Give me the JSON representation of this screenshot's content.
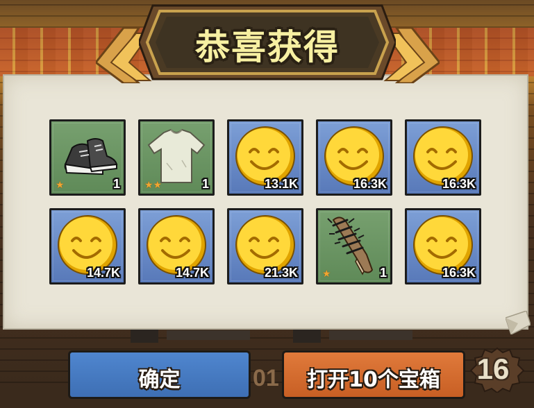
{
  "title": "恭喜获得",
  "items": [
    {
      "name": "sneakers",
      "icon": "sneakers-icon",
      "bg": "green",
      "stars": "★",
      "count": "1"
    },
    {
      "name": "t-shirt",
      "icon": "tshirt-icon",
      "bg": "green",
      "stars": "★★",
      "count": "1"
    },
    {
      "name": "coin",
      "icon": "smiley-coin-icon",
      "bg": "blue",
      "stars": "",
      "count": "13.1K"
    },
    {
      "name": "coin",
      "icon": "smiley-coin-icon",
      "bg": "blue",
      "stars": "",
      "count": "16.3K"
    },
    {
      "name": "coin",
      "icon": "smiley-coin-icon",
      "bg": "blue",
      "stars": "",
      "count": "16.3K"
    },
    {
      "name": "coin",
      "icon": "smiley-coin-icon",
      "bg": "blue",
      "stars": "",
      "count": "14.7K"
    },
    {
      "name": "coin",
      "icon": "smiley-coin-icon",
      "bg": "blue",
      "stars": "",
      "count": "14.7K"
    },
    {
      "name": "coin",
      "icon": "smiley-coin-icon",
      "bg": "blue",
      "stars": "",
      "count": "21.3K"
    },
    {
      "name": "spiked-bat",
      "icon": "spiked-bat-icon",
      "bg": "green",
      "stars": "★",
      "count": "1"
    },
    {
      "name": "coin",
      "icon": "smiley-coin-icon",
      "bg": "blue",
      "stars": "",
      "count": "16.3K"
    }
  ],
  "buttons": {
    "confirm": "确定",
    "open_ten": "打开10个宝箱"
  },
  "background_text": {
    "partial_number": "01",
    "badge_number": "16"
  },
  "colors": {
    "title_text": "#f7f0a2",
    "panel": "#e9e5d7",
    "slot_green": "#6b9663",
    "slot_blue": "#6a8cc8",
    "confirm_button": "#4a7fc6",
    "open_button": "#d86d2f",
    "star": "#f1a531"
  }
}
